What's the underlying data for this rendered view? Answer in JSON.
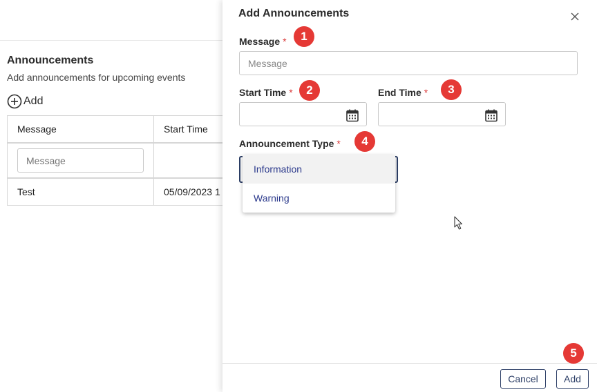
{
  "background": {
    "title": "Announcements",
    "subtitle": "Add announcements for upcoming events",
    "add_label": "Add",
    "table": {
      "headers": [
        "Message",
        "Start Time"
      ],
      "filter_placeholder": "Message",
      "rows": [
        {
          "message": "Test",
          "start_time": "05/09/2023 1"
        }
      ]
    }
  },
  "drawer": {
    "title": "Add Announcements",
    "message_label": "Message",
    "message_placeholder": "Message",
    "start_time_label": "Start Time",
    "end_time_label": "End Time",
    "type_label": "Announcement Type",
    "required_mark": "*",
    "dropdown_options": [
      "Information",
      "Warning"
    ],
    "cancel_label": "Cancel",
    "add_label": "Add"
  },
  "annotations": [
    "1",
    "2",
    "3",
    "4",
    "5"
  ],
  "colors": {
    "accent": "#2c3e66",
    "option_text": "#2c3a8c",
    "required": "#d93838",
    "badge": "#e53935"
  },
  "icons": [
    "plus-circle-icon",
    "close-icon",
    "calendar-icon",
    "mouse-cursor-icon"
  ]
}
